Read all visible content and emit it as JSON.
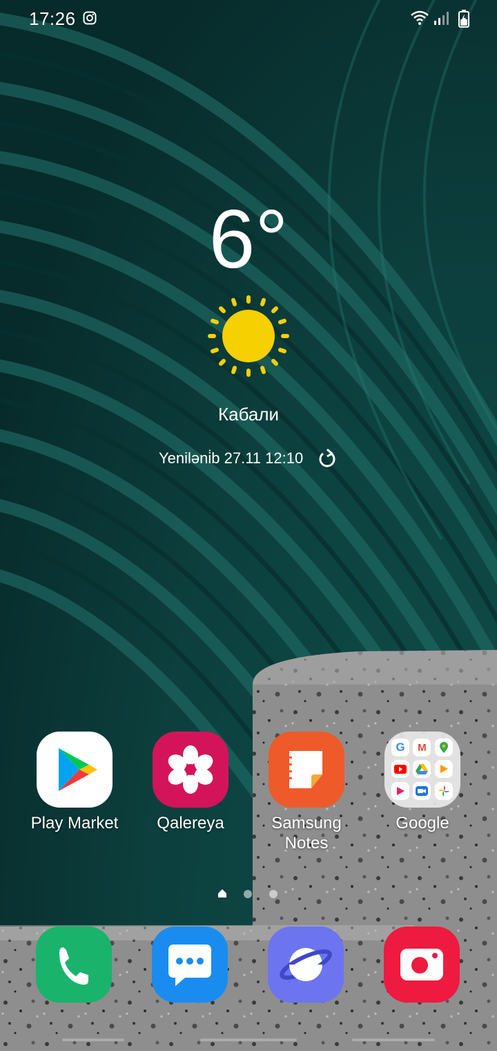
{
  "status_bar": {
    "time": "17:26"
  },
  "weather": {
    "temperature": "6°",
    "city": "Кабали",
    "updated_text": "Yeniləni̇b 27.11 12:10"
  },
  "apps": [
    {
      "label": "Play Market"
    },
    {
      "label": "Qalereya"
    },
    {
      "label": "Samsung Notes"
    },
    {
      "label": "Google"
    }
  ],
  "colors": {
    "wallpaper_teal": "#0e4a47",
    "sun_yellow": "#f6d000",
    "gallery_red": "#d4145a",
    "notes_orange": "#ee5a2a",
    "phone_green": "#19b36b",
    "messages_blue": "#1a8cf0",
    "internet_purple": "#6c74f0",
    "camera_red": "#ee1a3f"
  },
  "dock": [
    "phone-app",
    "messages-app",
    "internet-app",
    "camera-app"
  ]
}
